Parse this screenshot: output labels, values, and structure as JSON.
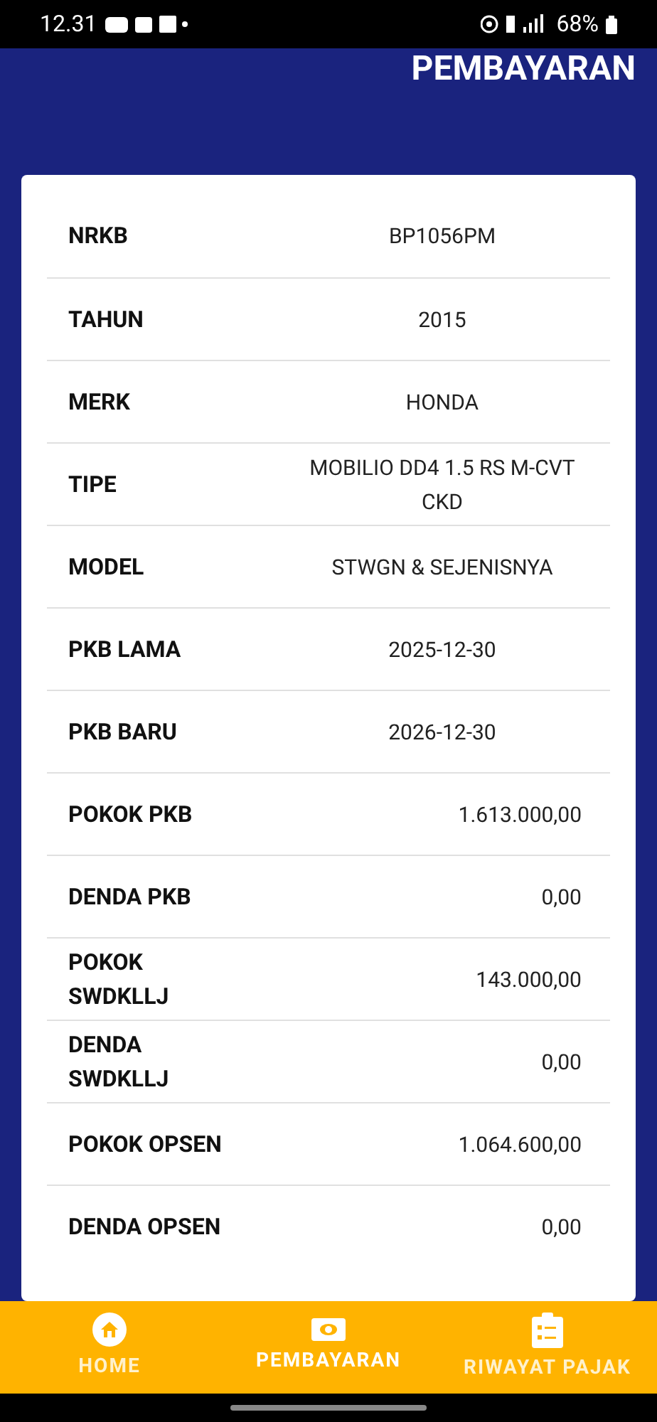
{
  "status_bar": {
    "time": "12.31",
    "battery": "68%"
  },
  "header": {
    "title": "PEMBAYARAN"
  },
  "details": [
    {
      "label": "NRKB",
      "value": "BP1056PM",
      "kind": "text"
    },
    {
      "label": "TAHUN",
      "value": "2015",
      "kind": "text"
    },
    {
      "label": "MERK",
      "value": "HONDA",
      "kind": "text"
    },
    {
      "label": "TIPE",
      "value": "MOBILIO DD4 1.5 RS M-CVT CKD",
      "kind": "text"
    },
    {
      "label": "MODEL",
      "value": "STWGN & SEJENISNYA",
      "kind": "text"
    },
    {
      "label": "PKB LAMA",
      "value": "2025-12-30",
      "kind": "text"
    },
    {
      "label": "PKB BARU",
      "value": "2026-12-30",
      "kind": "text"
    },
    {
      "label": "POKOK PKB",
      "value": "1.613.000,00",
      "kind": "amount"
    },
    {
      "label": "DENDA PKB",
      "value": "0,00",
      "kind": "amount"
    },
    {
      "label": "POKOK SWDKLLJ",
      "value": "143.000,00",
      "kind": "amount"
    },
    {
      "label": "DENDA SWDKLLJ",
      "value": "0,00",
      "kind": "amount"
    },
    {
      "label": "POKOK OPSEN",
      "value": "1.064.600,00",
      "kind": "amount"
    },
    {
      "label": "DENDA OPSEN",
      "value": "0,00",
      "kind": "amount"
    }
  ],
  "bottom_nav": [
    {
      "label": "HOME",
      "kind": "home",
      "selected": false
    },
    {
      "label": "PEMBAYARAN",
      "kind": "payment",
      "selected": true
    },
    {
      "label": "RIWAYAT PAJAK",
      "kind": "history",
      "selected": false
    }
  ]
}
